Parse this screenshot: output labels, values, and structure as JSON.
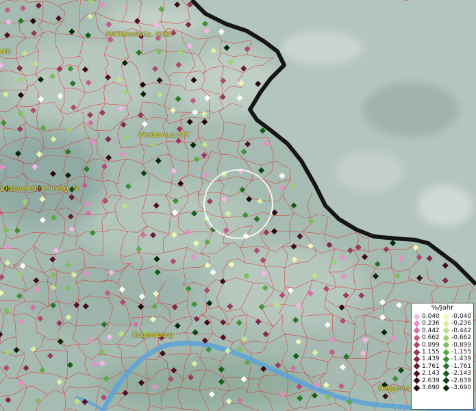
{
  "map": {
    "labels": [
      {
        "id": "marktredwitz",
        "text": "Marktredwitz, GKSt"
      },
      {
        "id": "weiden",
        "text": "Weiden i.d.OPf."
      },
      {
        "id": "sulzbach",
        "text": "Sulzbach-Rosenberg, St"
      },
      {
        "id": "regensburg",
        "text": "Regensburg"
      },
      {
        "id": "deggendorf",
        "text": "Deggend"
      },
      {
        "id": "edge-uth",
        "text": "uth"
      }
    ]
  },
  "legend": {
    "title": "%/Jahr",
    "positive": [
      {
        "value": "0.040",
        "color": "#f4b8e6"
      },
      {
        "value": "0.236",
        "color": "#e48fc6"
      },
      {
        "value": "0.442",
        "color": "#d271a6"
      },
      {
        "value": "0.662",
        "color": "#c25c8a"
      },
      {
        "value": "0.899",
        "color": "#b04a72"
      },
      {
        "value": "1.155",
        "color": "#993a5c"
      },
      {
        "value": "1.439",
        "color": "#82284a"
      },
      {
        "value": "1.761",
        "color": "#6b1b3a"
      },
      {
        "value": "2.143",
        "color": "#531129"
      },
      {
        "value": "2.639",
        "color": "#3c0a1b"
      },
      {
        "value": "3.690",
        "color": "#22040c"
      }
    ],
    "negative": [
      {
        "value": "-0.040",
        "color": "#eef7b8"
      },
      {
        "value": "-0.236",
        "color": "#d8efa0"
      },
      {
        "value": "-0.442",
        "color": "#bde28a"
      },
      {
        "value": "-0.662",
        "color": "#9dd274"
      },
      {
        "value": "-0.899",
        "color": "#7fbf5f"
      },
      {
        "value": "-1.155",
        "color": "#5fa94a"
      },
      {
        "value": "-1.439",
        "color": "#3f9136"
      },
      {
        "value": "-1.761",
        "color": "#267726"
      },
      {
        "value": "-2.143",
        "color": "#145f18"
      },
      {
        "value": "-2.639",
        "color": "#0a460f"
      },
      {
        "value": "-3.690",
        "color": "#032807"
      }
    ]
  },
  "colors": {
    "border": "#151515",
    "municipal_lines": "#e03030",
    "river": "#5ea4d6",
    "foreign_terrain": "#a9bcb7",
    "label_text": "#e8e23a",
    "highlight_circle": "#ffffff"
  }
}
